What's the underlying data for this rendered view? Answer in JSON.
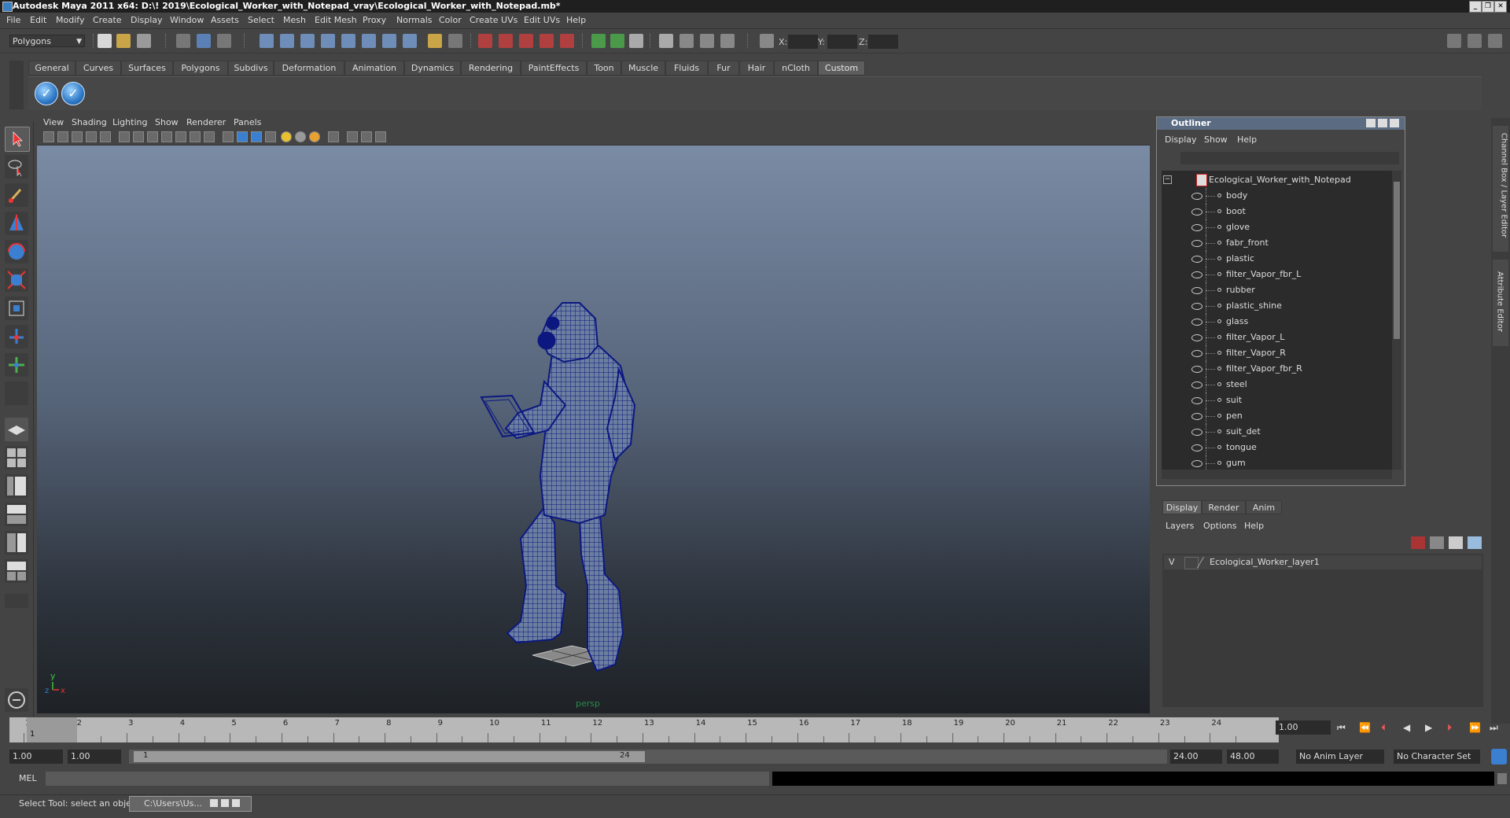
{
  "window": {
    "title": "Autodesk Maya 2011 x64: D:\\! 2019\\Ecological_Worker_with_Notepad_vray\\Ecological_Worker_with_Notepad.mb*",
    "minimize": "_",
    "restore": "❐",
    "close": "✕"
  },
  "menubar": [
    "File",
    "Edit",
    "Modify",
    "Create",
    "Display",
    "Window",
    "Assets",
    "Select",
    "Mesh",
    "Edit Mesh",
    "Proxy",
    "Normals",
    "Color",
    "Create UVs",
    "Edit UVs",
    "Help"
  ],
  "statusline": {
    "mode": "Polygons",
    "x_label": "X:",
    "y_label": "Y:",
    "z_label": "Z:"
  },
  "shelf": {
    "tabs": [
      "General",
      "Curves",
      "Surfaces",
      "Polygons",
      "Subdivs",
      "Deformation",
      "Animation",
      "Dynamics",
      "Rendering",
      "PaintEffects",
      "Toon",
      "Muscle",
      "Fluids",
      "Fur",
      "Hair",
      "nCloth",
      "Custom"
    ],
    "active_tab": "Custom",
    "icon_glyph": "✓"
  },
  "viewport": {
    "menus": [
      "View",
      "Shading",
      "Lighting",
      "Show",
      "Renderer",
      "Panels"
    ],
    "camera_label": "persp",
    "axis_y": "y",
    "axis_z": "z",
    "axis_x": "x",
    "wire_color": "#0c1880"
  },
  "outliner": {
    "title": "Outliner",
    "menus": [
      "Display",
      "Show",
      "Help"
    ],
    "root": "Ecological_Worker_with_Notepad",
    "items": [
      "body",
      "boot",
      "glove",
      "fabr_front",
      "plastic",
      "filter_Vapor_fbr_L",
      "rubber",
      "plastic_shine",
      "glass",
      "filter_Vapor_L",
      "filter_Vapor_R",
      "filter_Vapor_fbr_R",
      "steel",
      "suit",
      "pen",
      "suit_det",
      "tongue",
      "gum"
    ]
  },
  "layer_editor": {
    "tabs": [
      "Display",
      "Render",
      "Anim"
    ],
    "active_tab": "Display",
    "menus": [
      "Layers",
      "Options",
      "Help"
    ],
    "layer_visibility": "V",
    "layer_name": "Ecological_Worker_layer1"
  },
  "side_tabs": {
    "channel_box": "Channel Box / Layer Editor",
    "attribute_editor": "Attribute Editor"
  },
  "time_slider": {
    "ticks": [
      "1",
      "2",
      "3",
      "4",
      "5",
      "6",
      "7",
      "8",
      "9",
      "10",
      "11",
      "12",
      "13",
      "14",
      "15",
      "16",
      "17",
      "18",
      "19",
      "20",
      "21",
      "22",
      "23",
      "24"
    ],
    "current_frame_marker": "1",
    "current_frame": "1.00"
  },
  "range": {
    "start": "1.00",
    "anim_start": "1.00",
    "slider_start": "1",
    "slider_end": "24",
    "end": "24.00",
    "anim_end": "48.00",
    "anim_layer": "No Anim Layer",
    "character_set": "No Character Set"
  },
  "command_line": {
    "label": "MEL"
  },
  "help_line": {
    "text": "Select Tool: select an object",
    "taskbar_item": "C:\\Users\\Us..."
  }
}
